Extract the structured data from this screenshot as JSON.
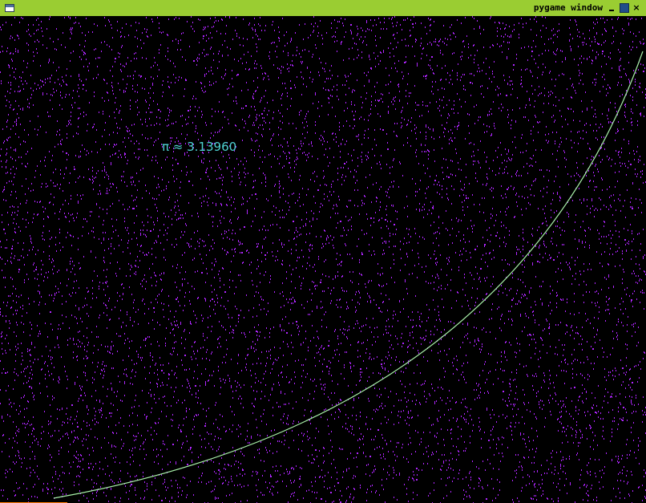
{
  "window": {
    "title": "pygame window",
    "close_glyph": "×",
    "controls": [
      "minimize-icon",
      "maximize-icon",
      "close-icon"
    ],
    "titlebar_color": "#9acd32"
  },
  "simulation": {
    "pi_estimate_text": "π ≈ 3.13960",
    "background_color": "#000000",
    "point_color": "#b026ff",
    "curve_color": "#a8f0a8",
    "text_color": "#4fd3d3"
  }
}
